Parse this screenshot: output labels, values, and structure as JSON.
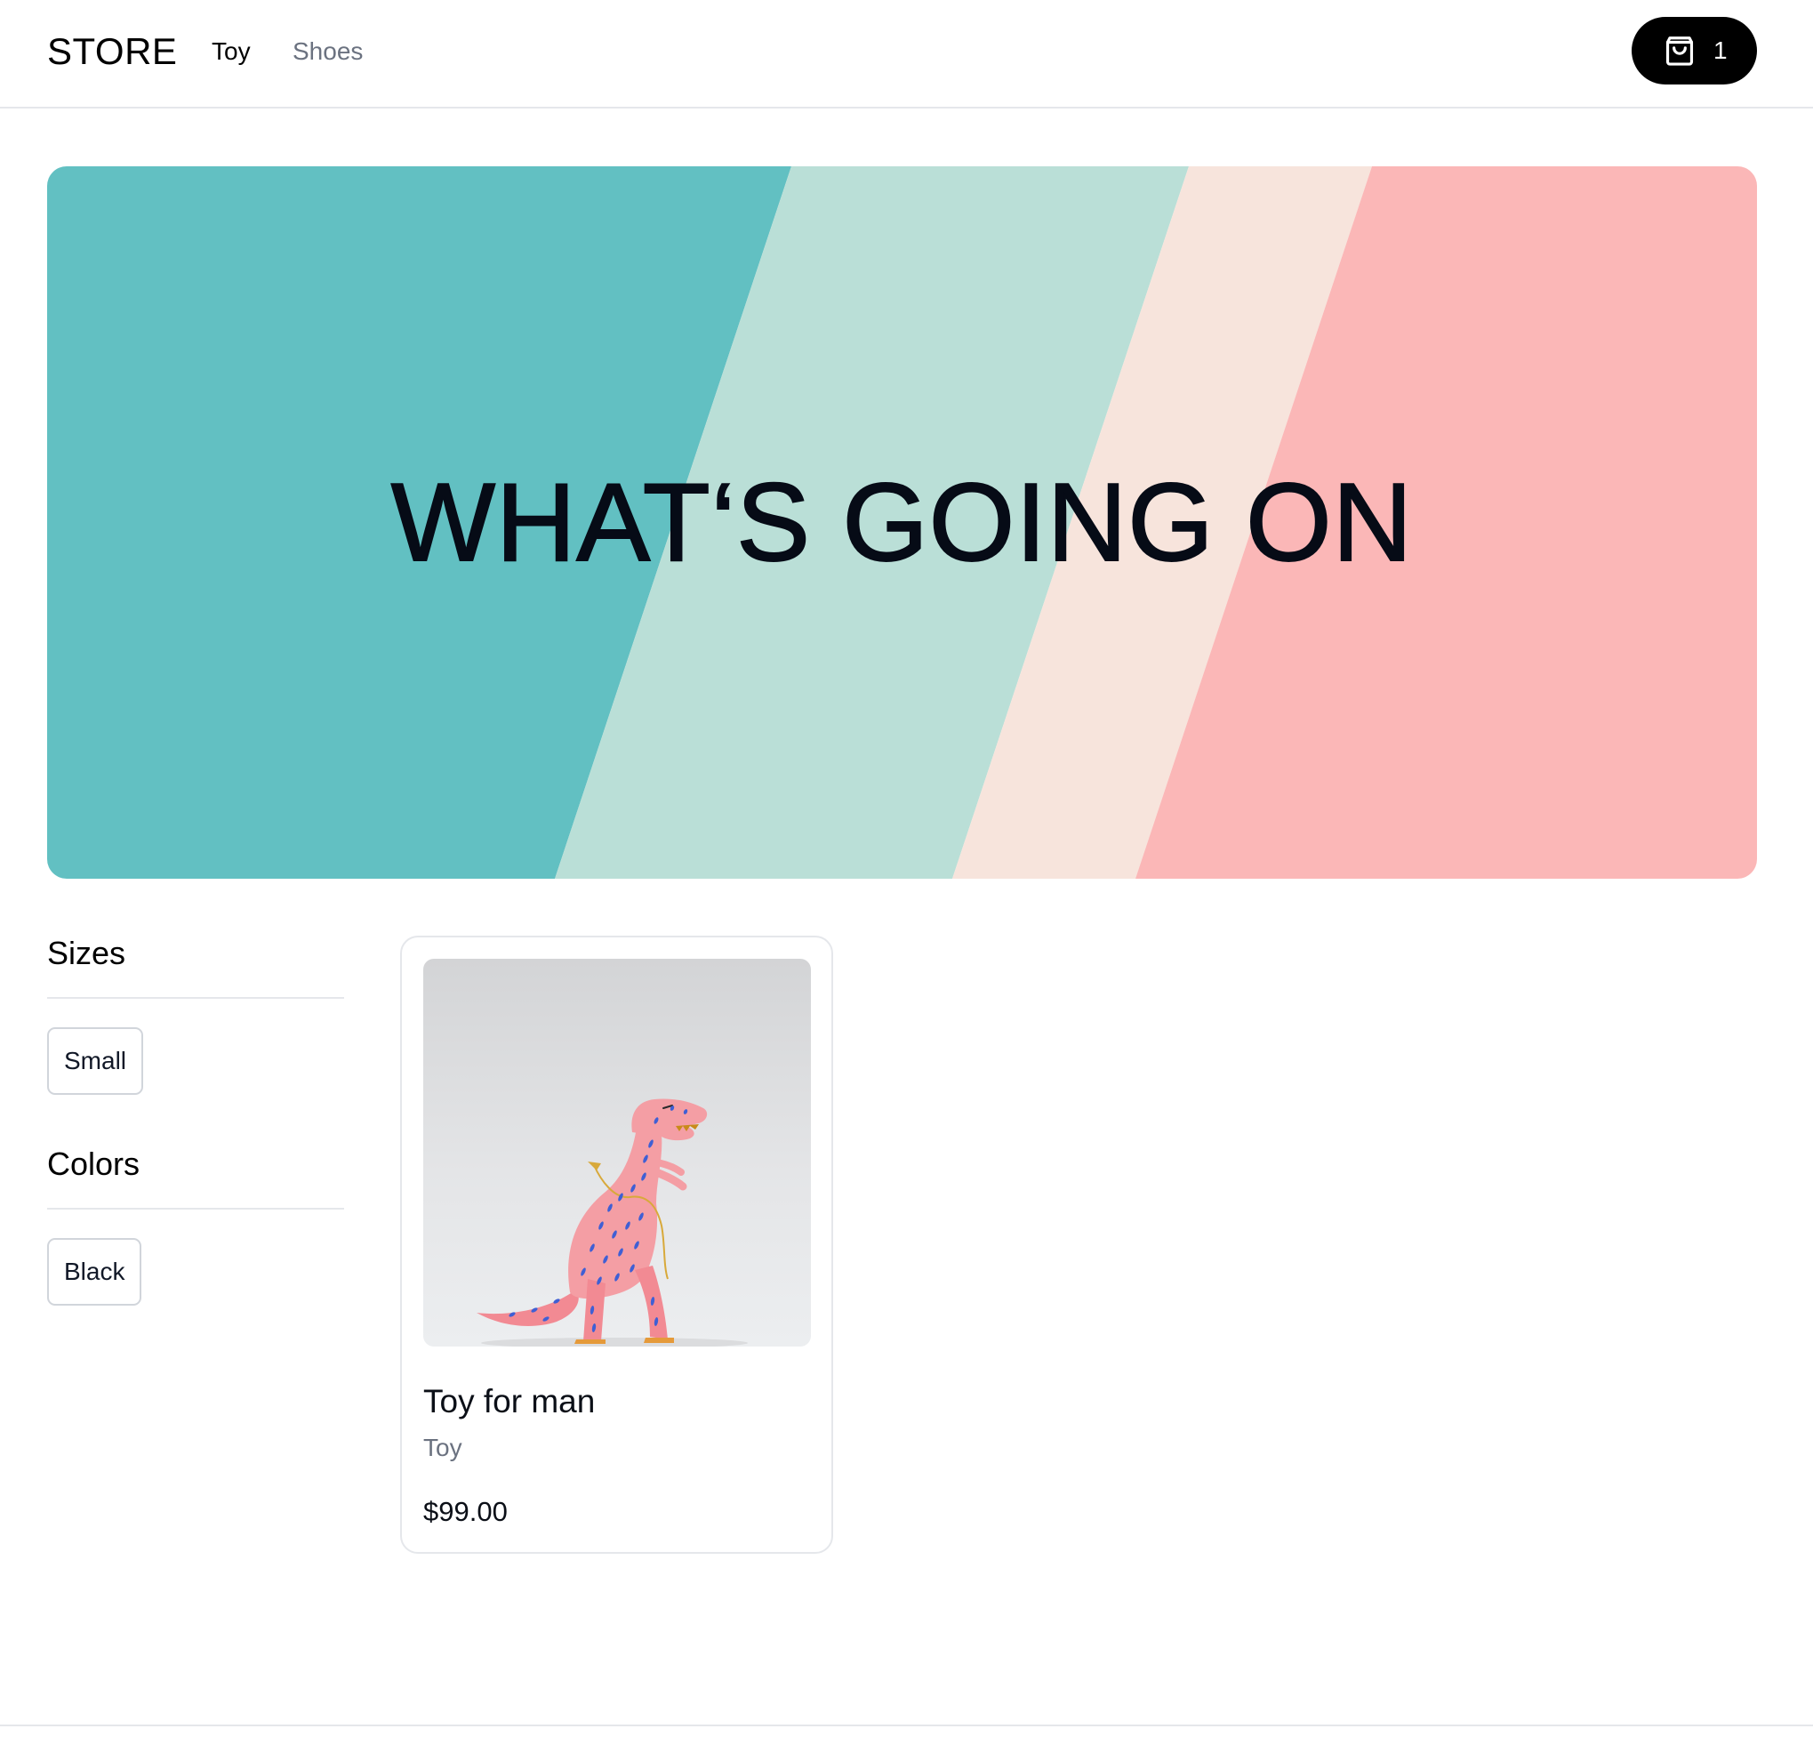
{
  "header": {
    "brand": "STORE",
    "nav": [
      {
        "label": "Toy",
        "active": true
      },
      {
        "label": "Shoes",
        "active": false
      }
    ],
    "cart": {
      "icon": "shopping-bag-icon",
      "count": "1"
    }
  },
  "hero": {
    "title": "WHAT‘S GOING ON",
    "stripe_colors": [
      "#62c0c2",
      "#badfd7",
      "#f7e4dc",
      "#fbb7b7"
    ]
  },
  "filters": {
    "sizes": {
      "title": "Sizes",
      "options": [
        "Small"
      ]
    },
    "colors": {
      "title": "Colors",
      "options": [
        "Black"
      ]
    }
  },
  "products": [
    {
      "name": "Toy for man",
      "category": "Toy",
      "price": "$99.00",
      "image": "pink-dinosaur-toy"
    }
  ],
  "theme": {
    "accent": "#000000",
    "muted_text": "#6b7280",
    "border": "#e5e7eb"
  }
}
